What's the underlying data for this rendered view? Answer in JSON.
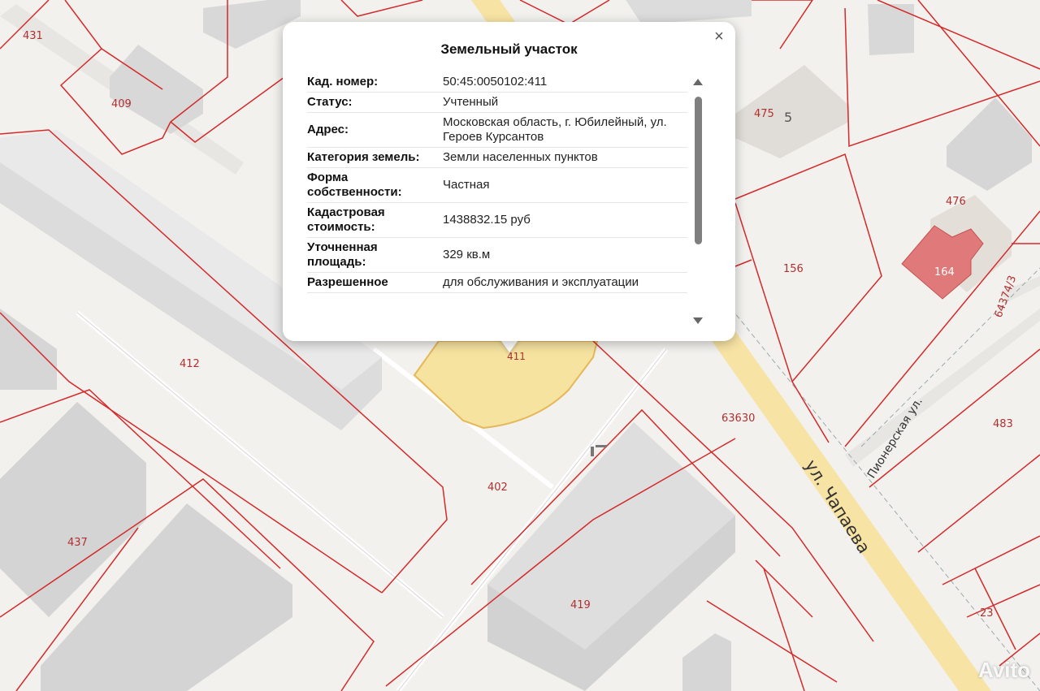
{
  "popup": {
    "title": "Земельный участок",
    "rows": [
      {
        "key": "Кад. номер:",
        "value": "50:45:0050102:411"
      },
      {
        "key": "Статус:",
        "value": "Учтенный"
      },
      {
        "key": "Адрес:",
        "value": "Московская область, г. Юбилейный, ул. Героев Курсантов"
      },
      {
        "key": "Категория земель:",
        "value": "Земли населенных пунктов"
      },
      {
        "key": "Форма собственности:",
        "value": "Частная"
      },
      {
        "key": "Кадастровая стоимость:",
        "value": "1438832.15 руб"
      },
      {
        "key": "Уточненная площадь:",
        "value": "329 кв.м"
      },
      {
        "key": "Разрешенное",
        "value": "для обслуживания и эксплуатации"
      }
    ]
  },
  "map": {
    "plot_labels": [
      "431",
      "409",
      "475",
      "5",
      "476",
      "164",
      "156",
      "412",
      "411",
      "63630",
      "483",
      "402",
      "437",
      "419",
      "23",
      "64374/3"
    ],
    "streets": [
      "ул. Чапаева",
      "Пионерская ул."
    ],
    "selected_plot": "411"
  },
  "watermark": "Avito",
  "colors": {
    "boundary": "#d42a2a",
    "selected_fill": "#f6e3a0",
    "road": "#f7e3a3",
    "building": "#d9d9d9",
    "highlight_building": "#e07a7a"
  }
}
